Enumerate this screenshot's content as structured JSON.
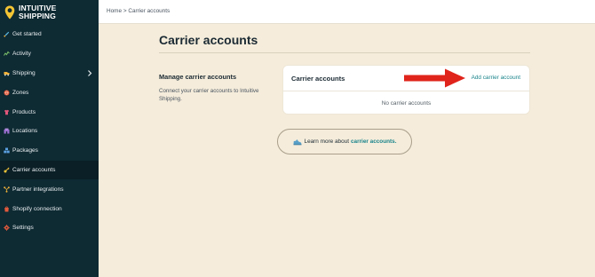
{
  "app": {
    "logo_line1": "INTUITIVE",
    "logo_line2": "SHIPPING"
  },
  "sidebar": {
    "items": [
      {
        "label": "Get started",
        "icon": "rocket-icon",
        "icon_color": "#5ab8e0"
      },
      {
        "label": "Activity",
        "icon": "activity-icon",
        "icon_color": "#7dc36a"
      },
      {
        "label": "Shipping",
        "icon": "shipping-icon",
        "icon_color": "#f0b23a"
      },
      {
        "label": "Zones",
        "icon": "zones-icon",
        "icon_color": "#e25a3c"
      },
      {
        "label": "Products",
        "icon": "products-icon",
        "icon_color": "#e0567a"
      },
      {
        "label": "Locations",
        "icon": "locations-icon",
        "icon_color": "#9b6fd0"
      },
      {
        "label": "Packages",
        "icon": "packages-icon",
        "icon_color": "#5aa0e0"
      },
      {
        "label": "Carrier accounts",
        "icon": "key-icon",
        "icon_color": "#f0c23a"
      },
      {
        "label": "Partner integrations",
        "icon": "integrations-icon",
        "icon_color": "#f0b23a"
      },
      {
        "label": "Shopify connection",
        "icon": "shopify-icon",
        "icon_color": "#e25a3c"
      },
      {
        "label": "Settings",
        "icon": "gear-icon",
        "icon_color": "#e25a3c"
      }
    ],
    "active": "Carrier accounts"
  },
  "breadcrumb": "Home > Carrier accounts",
  "main": {
    "title": "Carrier accounts",
    "section_title": "Manage carrier accounts",
    "section_desc": "Connect your carrier accounts to Intuitive Shipping.",
    "card_title": "Carrier accounts",
    "card_link": "Add carrier account",
    "card_empty": "No carrier accounts",
    "learn_prefix": "Learn more about",
    "learn_link": "carrier accounts."
  },
  "colors": {
    "sidebar_bg": "#0e2a33",
    "page_bg": "#f5ecdb",
    "link": "#18838a",
    "arrow": "#e0241b"
  }
}
